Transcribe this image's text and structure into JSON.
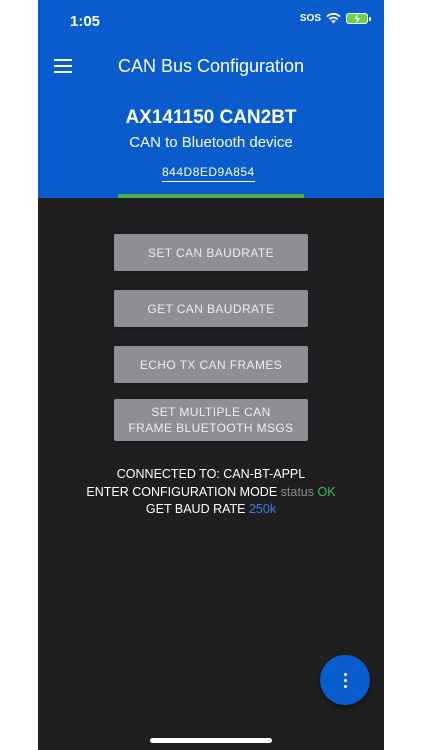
{
  "status_bar": {
    "time": "1:05",
    "sos": "SOS"
  },
  "header": {
    "title": "CAN Bus Configuration",
    "device_name": "AX141150 CAN2BT",
    "device_desc": "CAN to Bluetooth device",
    "device_id": "844D8ED9A854",
    "progress": 1.0
  },
  "buttons": [
    {
      "label": "SET CAN BAUDRATE"
    },
    {
      "label": "GET CAN BAUDRATE"
    },
    {
      "label": "ECHO TX CAN FRAMES"
    },
    {
      "label": "SET MULTIPLE CAN FRAME BLUETOOTH MSGS"
    }
  ],
  "status": {
    "connected_label": "CONNECTED TO: CAN-BT-APPL",
    "config_mode_label": "ENTER CONFIGURATION MODE",
    "config_mode_status_word": "status",
    "config_mode_value": "OK",
    "baud_label": "GET BAUD RATE",
    "baud_value": "250k"
  },
  "colors": {
    "header": "#0a5ccc",
    "background": "#1f1f22",
    "button": "#8e8e93",
    "ok": "#3dbb4a",
    "baud": "#3a7fe0",
    "progress": "#4caf50"
  },
  "icons": {
    "menu": "hamburger-menu-icon",
    "fab": "more-vertical-icon"
  }
}
